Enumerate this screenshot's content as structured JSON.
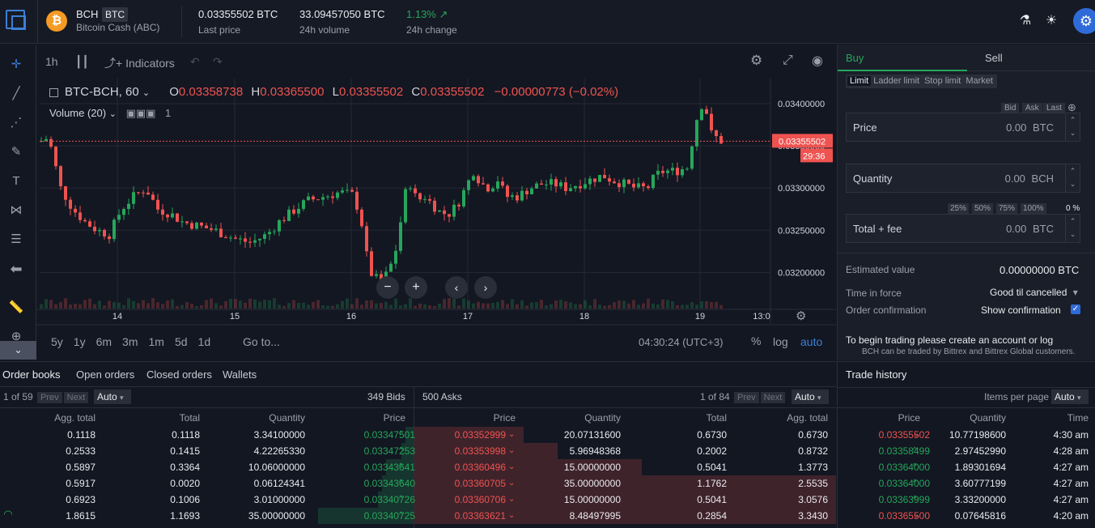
{
  "header": {
    "coin_symbol": "BCH",
    "coin_badge": "BTC",
    "coin_name": "Bitcoin Cash (ABC)",
    "last_price": "0.03355502 BTC",
    "last_price_label": "Last price",
    "volume": "33.09457050 BTC",
    "volume_label": "24h volume",
    "change": "1.13%",
    "change_arrow": "↗",
    "change_label": "24h change"
  },
  "chart_toolbar": {
    "interval": "1h",
    "indicators": "Indicators"
  },
  "legend": {
    "symbol": "BTC-BCH, 60",
    "o_label": "O",
    "o": "0.03358738",
    "h_label": "H",
    "h": "0.03365500",
    "l_label": "L",
    "l": "0.03355502",
    "c_label": "C",
    "c": "0.03355502",
    "change": "−0.00000773 (−0.02%)"
  },
  "volume_indicator": {
    "label": "Volume (20)",
    "count": "1"
  },
  "price_axis": {
    "labels": [
      "0.03400000",
      "0.03350000",
      "0.03300000",
      "0.03250000",
      "0.03200000"
    ],
    "current": "0.03355502",
    "countdown": "29:36"
  },
  "time_axis": {
    "labels": [
      "14",
      "15",
      "16",
      "17",
      "18",
      "19",
      "13:0"
    ]
  },
  "periods": [
    "5y",
    "1y",
    "6m",
    "3m",
    "1m",
    "5d",
    "1d"
  ],
  "goto": "Go to...",
  "clock": "04:30:24 (UTC+3)",
  "scale": {
    "percent": "%",
    "log": "log",
    "auto": "auto"
  },
  "chart_data": {
    "type": "candlestick",
    "ylim": [
      0.0318,
      0.0342
    ],
    "current_price": 0.03355502,
    "candles": []
  },
  "order_form": {
    "tab_buy": "Buy",
    "tab_sell": "Sell",
    "types": [
      "Limit",
      "Ladder limit",
      "Stop limit",
      "Market"
    ],
    "bid": "Bid",
    "ask": "Ask",
    "last": "Last",
    "price_label": "Price",
    "price_value": "0.00",
    "price_unit": "BTC",
    "qty_label": "Quantity",
    "qty_value": "0.00",
    "qty_unit": "BCH",
    "pcts": [
      "25%",
      "50%",
      "75%",
      "100%"
    ],
    "pct_value": "0 %",
    "total_label": "Total + fee",
    "total_value": "0.00",
    "total_unit": "BTC",
    "est_label": "Estimated value",
    "est_value": "0.00000000 BTC",
    "tif_label": "Time in force",
    "tif_value": "Good til cancelled",
    "confirm_label": "Order confirmation",
    "confirm_value": "Show confirmation",
    "notice": "To begin trading please create an account or log",
    "notice2": "BCH can be traded by Bittrex and Bittrex Global customers."
  },
  "bottom_tabs": [
    "Order books",
    "Open orders",
    "Closed orders",
    "Wallets"
  ],
  "bids": {
    "page": "1 of 59",
    "prev": "Prev",
    "next": "Next",
    "auto": "Auto",
    "count": "349 Bids",
    "headers": [
      "Agg. total",
      "Total",
      "Quantity",
      "Price"
    ],
    "rows": [
      [
        "0.1118",
        "0.1118",
        "3.34100000",
        "0.03347501"
      ],
      [
        "0.2533",
        "0.1415",
        "4.22265330",
        "0.03347253"
      ],
      [
        "0.5897",
        "0.3364",
        "10.06000000",
        "0.03343641"
      ],
      [
        "0.5917",
        "0.0020",
        "0.06124341",
        "0.03343640"
      ],
      [
        "0.6923",
        "0.1006",
        "3.01000000",
        "0.03340726"
      ],
      [
        "1.8615",
        "1.1693",
        "35.00000000",
        "0.03340725"
      ]
    ],
    "depth": [
      0.02,
      0.03,
      0.07,
      0.08,
      0.09,
      0.24
    ]
  },
  "asks": {
    "count": "500 Asks",
    "page": "1 of 84",
    "prev": "Prev",
    "next": "Next",
    "auto": "Auto",
    "headers": [
      "Price",
      "Quantity",
      "Total",
      "Agg. total"
    ],
    "rows": [
      [
        "0.03352999",
        "20.07131600",
        "0.6730",
        "0.6730"
      ],
      [
        "0.03353998",
        "5.96948368",
        "0.2002",
        "0.8732"
      ],
      [
        "0.03360496",
        "15.00000000",
        "0.5041",
        "1.3773"
      ],
      [
        "0.03360705",
        "35.00000000",
        "1.1762",
        "2.5535"
      ],
      [
        "0.03360706",
        "15.00000000",
        "0.5041",
        "3.0576"
      ],
      [
        "0.03363621",
        "8.48497995",
        "0.2854",
        "3.3430"
      ]
    ],
    "depth": [
      0.26,
      0.34,
      0.54,
      1.0,
      1.0,
      1.0
    ]
  },
  "trade_history": {
    "title": "Trade history",
    "ipp_label": "Items per page",
    "auto": "Auto",
    "headers": [
      "Price",
      "Quantity",
      "Time"
    ],
    "rows": [
      [
        "0.03355502",
        "10.77198600",
        "4:30 am",
        "sell"
      ],
      [
        "0.03358499",
        "2.97452990",
        "4:28 am",
        "buy"
      ],
      [
        "0.03364000",
        "1.89301694",
        "4:27 am",
        "buy"
      ],
      [
        "0.03364000",
        "3.60777199",
        "4:27 am",
        "buy"
      ],
      [
        "0.03363999",
        "3.33200000",
        "4:27 am",
        "buy"
      ],
      [
        "0.03365500",
        "0.07645816",
        "4:20 am",
        "sell"
      ]
    ]
  },
  "colors": {
    "up": "#26a65b",
    "down": "#ef5350",
    "accent": "#2f6bd8"
  }
}
